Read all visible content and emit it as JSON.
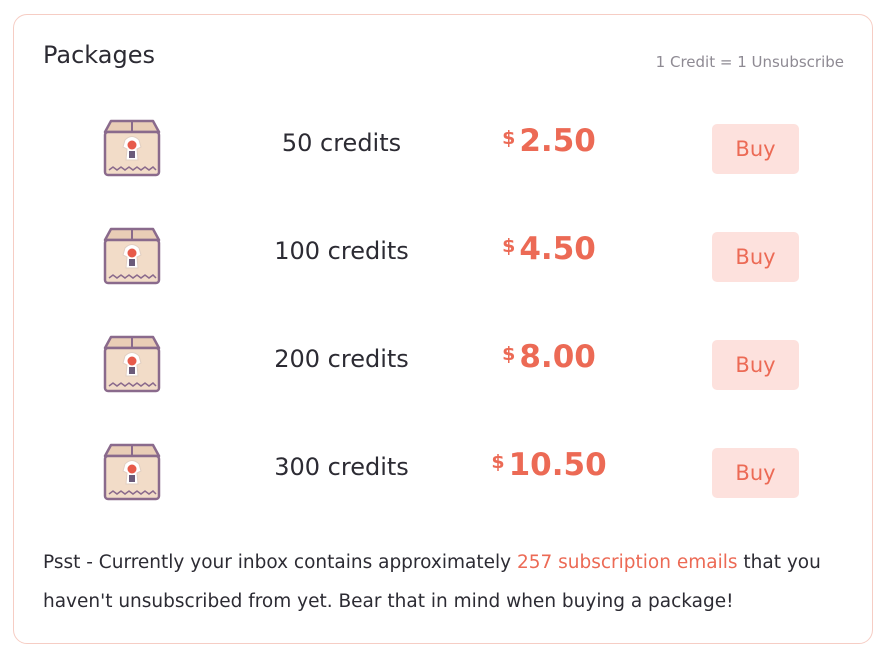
{
  "header": {
    "title": "Packages",
    "rate": "1 Credit = 1 Unsubscribe"
  },
  "packages": [
    {
      "credits": "50 credits",
      "currency": "$",
      "price": "2.50",
      "buy_label": "Buy"
    },
    {
      "credits": "100 credits",
      "currency": "$",
      "price": "4.50",
      "buy_label": "Buy"
    },
    {
      "credits": "200 credits",
      "currency": "$",
      "price": "8.00",
      "buy_label": "Buy"
    },
    {
      "credits": "300 credits",
      "currency": "$",
      "price": "10.50",
      "buy_label": "Buy"
    }
  ],
  "note": {
    "prefix": "Psst - Currently your inbox contains approximately ",
    "highlight": "257 subscription emails",
    "suffix": " that you haven't unsubscribed from yet. Bear that in mind when buying a package!"
  },
  "icons": {
    "package": "package-box-icon"
  },
  "colors": {
    "accent": "#ec6a55",
    "button_bg": "#fde1dd",
    "border": "#f6cdc4",
    "text": "#2c2b33",
    "muted": "#8e8a93"
  }
}
